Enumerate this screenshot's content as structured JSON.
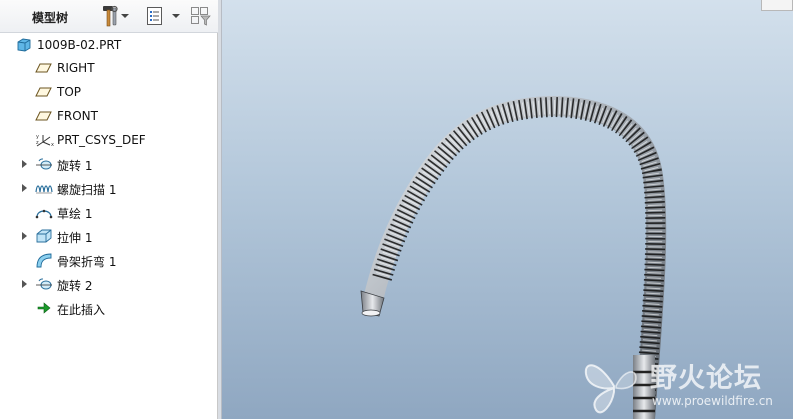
{
  "model_tree": {
    "title": "模型树",
    "toolbar": {
      "settings_icon": "hammer-wrench-icon",
      "show_icon": "list-view-icon",
      "filter_icon": "filter-icon"
    },
    "items": [
      {
        "label": "1009B-02.PRT",
        "icon": "part-icon",
        "expandable": false
      },
      {
        "label": "RIGHT",
        "icon": "datum-plane-icon",
        "expandable": false
      },
      {
        "label": "TOP",
        "icon": "datum-plane-icon",
        "expandable": false
      },
      {
        "label": "FRONT",
        "icon": "datum-plane-icon",
        "expandable": false
      },
      {
        "label": "PRT_CSYS_DEF",
        "icon": "coordinate-system-icon",
        "expandable": false
      },
      {
        "label": "旋转 1",
        "icon": "revolve-icon",
        "expandable": true
      },
      {
        "label": "螺旋扫描 1",
        "icon": "helical-sweep-icon",
        "expandable": true
      },
      {
        "label": "草绘 1",
        "icon": "sketch-icon",
        "expandable": false
      },
      {
        "label": "拉伸 1",
        "icon": "extrude-icon",
        "expandable": true
      },
      {
        "label": "骨架折弯 1",
        "icon": "spinal-bend-icon",
        "expandable": false
      },
      {
        "label": "旋转 2",
        "icon": "revolve-icon",
        "expandable": true
      },
      {
        "label": "在此插入",
        "icon": "insert-here-arrow-icon",
        "expandable": false
      }
    ]
  },
  "viewport": {
    "model": "flexible-hose-model",
    "background_top": "#d3e0ec",
    "background_bottom": "#8fa7c1"
  },
  "watermark": {
    "title": "野火论坛",
    "url": "www.proewildfire.cn"
  }
}
